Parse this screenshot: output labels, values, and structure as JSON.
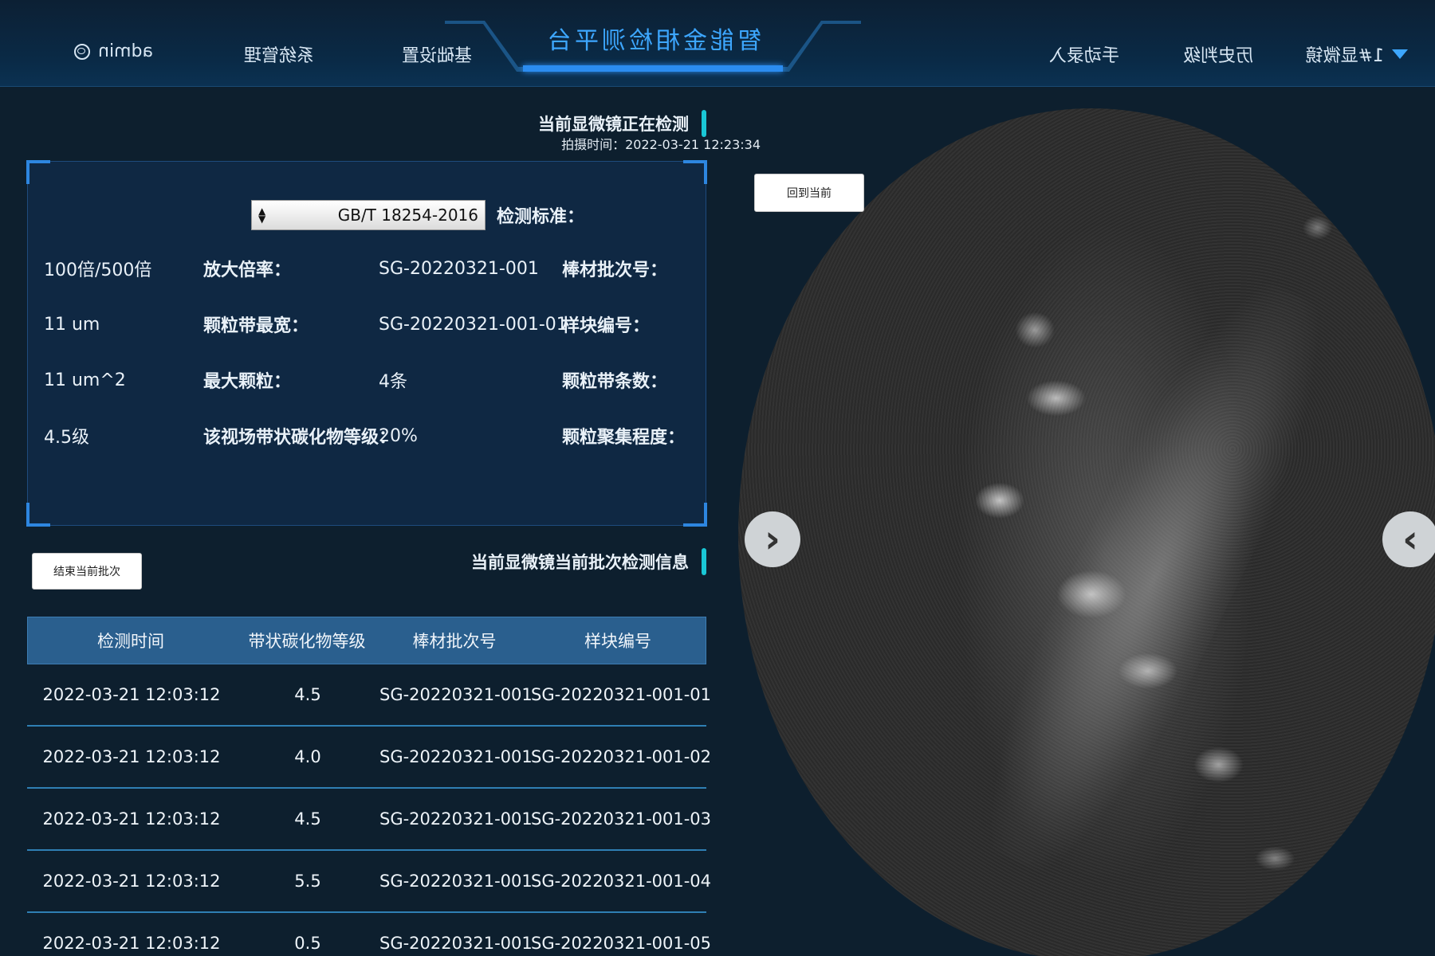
{
  "header": {
    "title": "智能金相检测平台",
    "nav_left": [
      {
        "label": "手动录入"
      },
      {
        "label": "历史判级"
      },
      {
        "label": "1#显微镜"
      }
    ],
    "nav_right": [
      {
        "label": "基础设置"
      },
      {
        "label": "系统管理"
      }
    ],
    "user": "admin",
    "colors": {
      "accent": "#2b8cf0",
      "title": "#3da7ff"
    }
  },
  "detect_section": {
    "heading": "当前显微镜正在检测",
    "standard_label": "检测标准：",
    "standard_value": "GB/T 18254-2016",
    "fields": [
      {
        "label": "棒材批次号：",
        "value": "SG-20220321-001"
      },
      {
        "label": "放大倍率：",
        "value": "100倍/500倍"
      },
      {
        "label": "样块编号：",
        "value": "SG-20220321-001-01"
      },
      {
        "label": "颗粒带最宽：",
        "value": "11 um"
      },
      {
        "label": "颗粒带条数：",
        "value": "4条"
      },
      {
        "label": "最大颗粒：",
        "value": "11 um^2"
      },
      {
        "label": "颗粒聚集程度：",
        "value": "20%"
      },
      {
        "label": "该视场带状碳化物等级：",
        "value": "4.5级"
      }
    ]
  },
  "batch_section": {
    "heading": "当前显微镜当前批次检测信息",
    "end_button": "结束当前批次",
    "columns": [
      "样块编号",
      "棒材批次号",
      "带状碳化物等级",
      "检测时间"
    ],
    "rows": [
      [
        "SG-20220321-001-01",
        "SG-20220321-001",
        "4.5",
        "2022-03-21 12:03:12"
      ],
      [
        "SG-20220321-001-02",
        "SG-20220321-001",
        "4.0",
        "2022-03-21 12:03:12"
      ],
      [
        "SG-20220321-001-03",
        "SG-20220321-001",
        "4.5",
        "2022-03-21 12:03:12"
      ],
      [
        "SG-20220321-001-04",
        "SG-20220321-001",
        "5.5",
        "2022-03-21 12:03:12"
      ],
      [
        "SG-20220321-001-05",
        "SG-20220321-001",
        "0.5",
        "2022-03-21 12:03:12"
      ]
    ]
  },
  "viewer": {
    "capture_time": "拍摄时间：2022-03-21 12:23:34",
    "back_button": "回到当前",
    "prev_glyph": "‹",
    "next_glyph": "›"
  }
}
